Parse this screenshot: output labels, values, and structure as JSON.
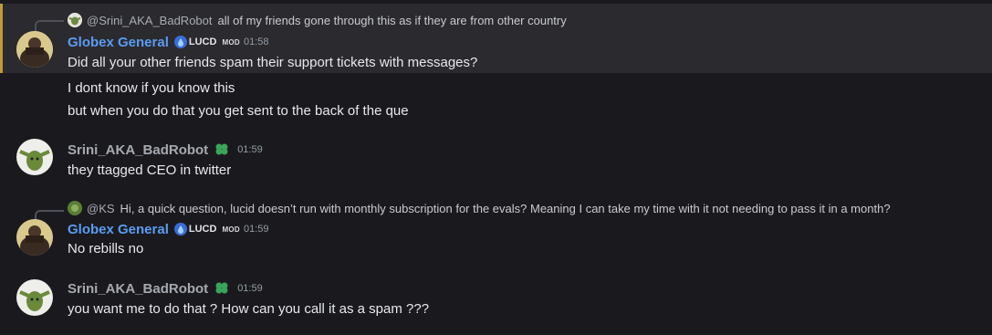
{
  "messages": [
    {
      "reply": {
        "author": "@Srini_AKA_BadRobot",
        "text": "all of my friends gone through this as if they are from other country"
      },
      "author": "Globex General",
      "role": "LUCD",
      "mod": "MOD",
      "time": "01:58",
      "lines": [
        "Did all your other friends spam their support tickets with messages?",
        "I dont know if you know this",
        "but when you do that you get sent to the back of the que"
      ]
    },
    {
      "author": "Srini_AKA_BadRobot",
      "time": "01:59",
      "lines": [
        "they ttagged CEO in twitter"
      ]
    },
    {
      "reply": {
        "author": "@KS",
        "text": "Hi, a quick question, lucid doesn’t run with monthly subscription for the evals? Meaning I can take my time with it not needing to pass it in a month?"
      },
      "author": "Globex General",
      "role": "LUCD",
      "mod": "MOD",
      "time": "01:59",
      "lines": [
        "No rebills no"
      ]
    },
    {
      "author": "Srini_AKA_BadRobot",
      "time": "01:59",
      "lines": [
        "you want me to do that ? How can you call it as a spam  ???"
      ]
    }
  ],
  "colors": {
    "background": "#1a1a1e",
    "highlight": "#2a2a2f",
    "highlight_bar": "#c29a36",
    "mod_name": "#5b9cf0",
    "user_name": "#a6a9b0"
  },
  "icons": {
    "role": "water-drop-icon",
    "user_badge": "clover-icon"
  }
}
